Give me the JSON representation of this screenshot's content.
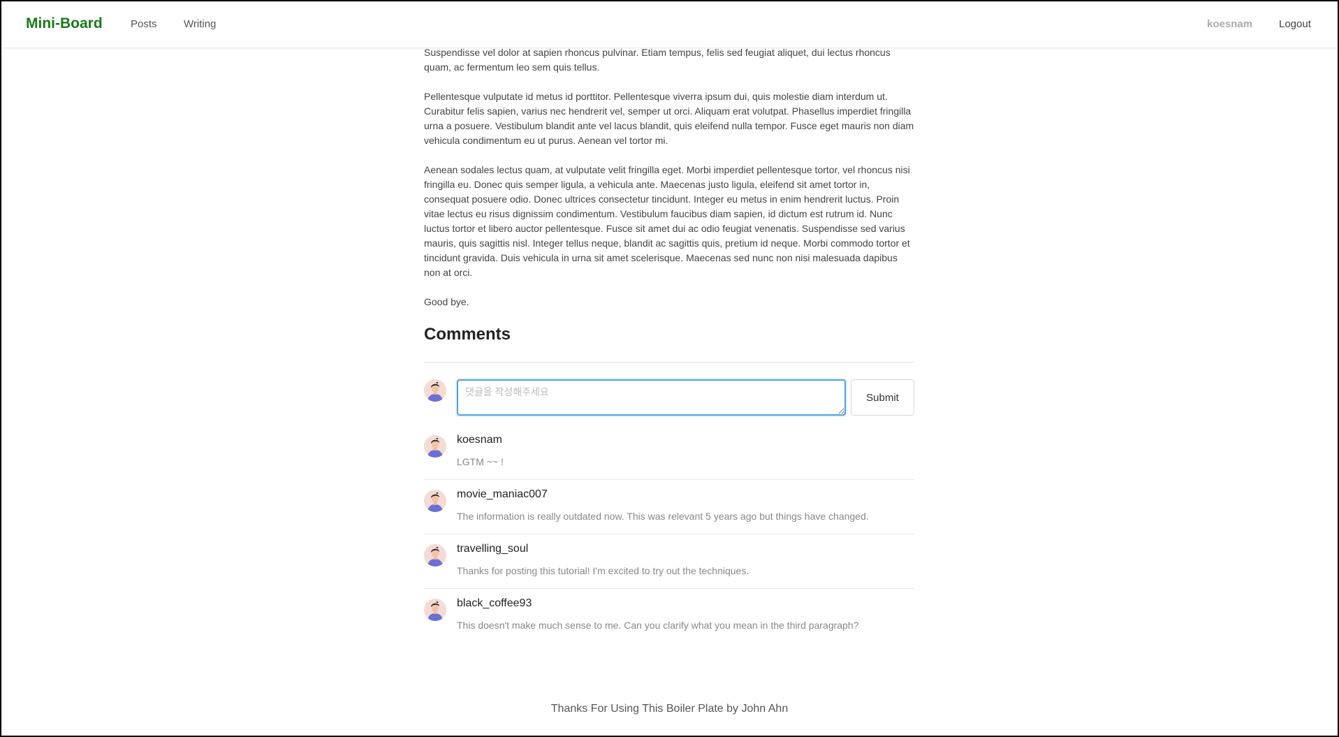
{
  "header": {
    "logo": "Mini-Board",
    "nav": [
      "Posts",
      "Writing"
    ],
    "username": "koesnam",
    "logout_label": "Logout"
  },
  "article": {
    "partial_paragraph": "Suspendisse posuere aliquet tempor. Etiam libero erat, rhoncus ut magna et, varius scelerisque erat. Suspendisse vel dolor at sapien rhoncus pulvinar. Etiam tempus, felis sed feugiat aliquet, dui lectus rhoncus quam, ac fermentum leo sem quis tellus.",
    "paragraphs": [
      "Pellentesque vulputate id metus id porttitor. Pellentesque viverra ipsum dui, quis molestie diam interdum ut. Curabitur felis sapien, varius nec hendrerit vel, semper ut orci. Aliquam erat volutpat. Phasellus imperdiet fringilla urna a posuere. Vestibulum blandit ante vel lacus blandit, quis eleifend nulla tempor. Fusce eget mauris non diam vehicula condimentum eu ut purus. Aenean vel tortor mi.",
      "Aenean sodales lectus quam, at vulputate velit fringilla eget. Morbi imperdiet pellentesque tortor, vel rhoncus nisi fringilla eu. Donec quis semper ligula, a vehicula ante. Maecenas justo ligula, eleifend sit amet tortor in, consequat posuere odio. Donec ultrices consectetur tincidunt. Integer eu metus in enim hendrerit luctus. Proin vitae lectus eu risus dignissim condimentum. Vestibulum faucibus diam sapien, id dictum est rutrum id. Nunc luctus tortor et libero auctor pellentesque. Fusce sit amet dui ac odio feugiat venenatis. Suspendisse sed varius mauris, quis sagittis nisl. Integer tellus neque, blandit ac sagittis quis, pretium id neque. Morbi commodo tortor et tincidunt gravida. Duis vehicula in urna sit amet scelerisque. Maecenas sed nunc non nisi malesuada dapibus non at orci.",
      "Good bye."
    ]
  },
  "comments_section": {
    "title": "Comments",
    "input_placeholder": "댓글을 작성해주세요",
    "input_value": "",
    "submit_label": "Submit",
    "comments": [
      {
        "author": "koesnam",
        "text": "LGTM ~~ !"
      },
      {
        "author": "movie_maniac007",
        "text": "The information is really outdated now. This was relevant 5 years ago but things have changed."
      },
      {
        "author": "travelling_soul",
        "text": "Thanks for posting this tutorial! I'm excited to try out the techniques."
      },
      {
        "author": "black_coffee93",
        "text": "This doesn't make much sense to me. Can you clarify what you mean in the third paragraph?"
      }
    ]
  },
  "footer": {
    "text": "Thanks For Using This Boiler Plate by John Ahn"
  },
  "colors": {
    "brand": "#1a7a1a",
    "input_focus": "#4da3e0",
    "avatar_shirt": "#6b6fd6"
  }
}
